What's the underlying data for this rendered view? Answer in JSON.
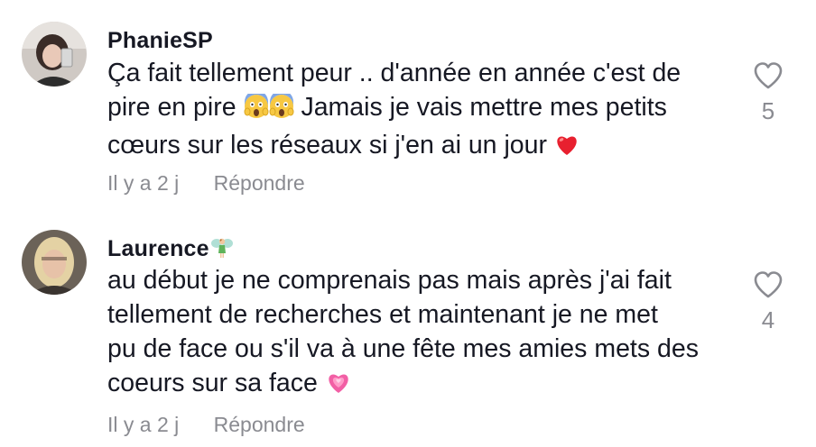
{
  "comments": [
    {
      "username": "PhanieSP",
      "lines": [
        "Ça fait tellement peur .. d'année en année c'est de",
        "pire en pire",
        "Jamais je vais mettre mes petits",
        "cœurs sur les réseaux si j'en ai un jour"
      ],
      "emojis": [
        "face-screaming-in-fear-icon",
        "face-screaming-in-fear-icon",
        "red-heart-icon"
      ],
      "time": "Il y a 2 j",
      "reply_label": "Répondre",
      "likes": "5"
    },
    {
      "username": "Laurence",
      "badge_icon": "fairy-icon",
      "lines": [
        "au début je ne comprenais pas mais après j'ai fait",
        "tellement de recherches et maintenant je ne met",
        "pu de face ou s'il va à une fête mes amies mets des",
        "coeurs sur sa face"
      ],
      "emojis": [
        "growing-heart-icon"
      ],
      "time": "Il y a 2 j",
      "reply_label": "Répondre",
      "likes": "4"
    }
  ],
  "colors": {
    "text": "#161823",
    "muted": "#8a8b91",
    "heart_red": "#e8202f",
    "pink_heart": "#f25fa5"
  }
}
